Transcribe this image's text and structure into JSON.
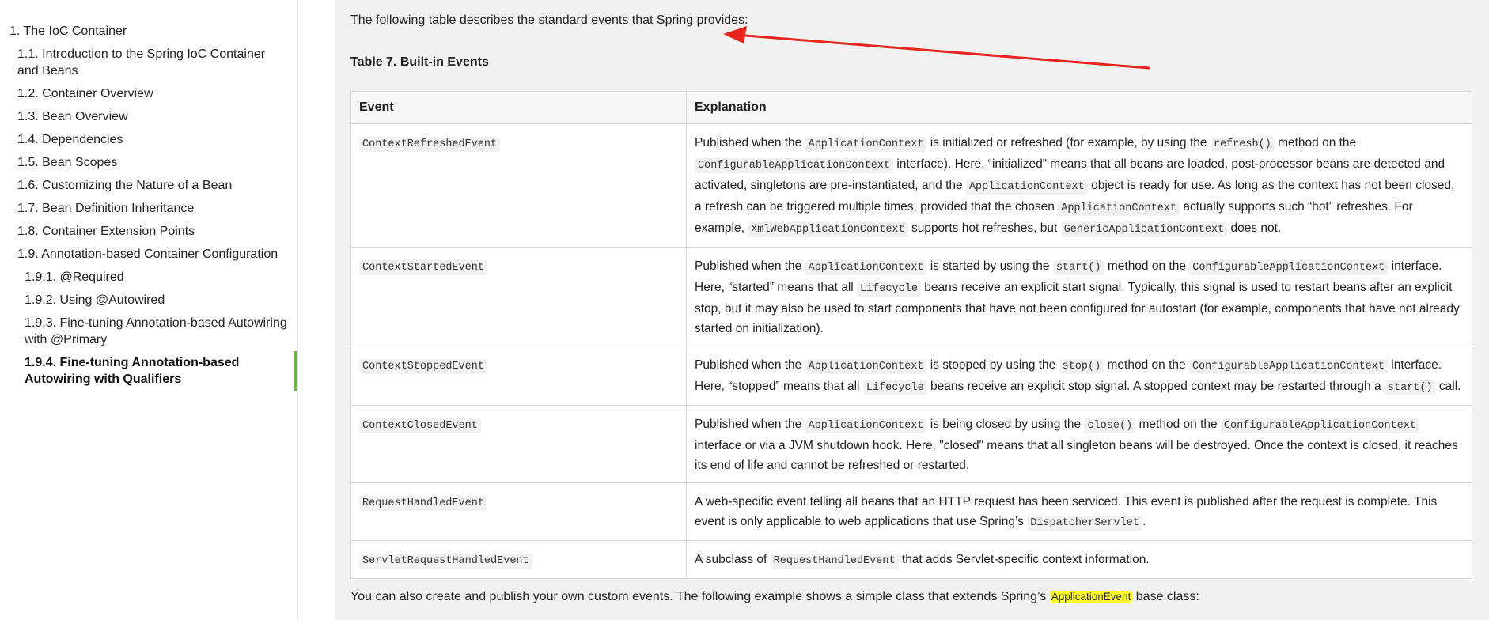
{
  "sidebar": {
    "items": [
      {
        "label": "1. The IoC Container"
      },
      {
        "label": "1.1. Introduction to the Spring IoC Container and Beans"
      },
      {
        "label": "1.2. Container Overview"
      },
      {
        "label": "1.3. Bean Overview"
      },
      {
        "label": "1.4. Dependencies"
      },
      {
        "label": "1.5. Bean Scopes"
      },
      {
        "label": "1.6. Customizing the Nature of a Bean"
      },
      {
        "label": "1.7. Bean Definition Inheritance"
      },
      {
        "label": "1.8. Container Extension Points"
      },
      {
        "label": "1.9. Annotation-based Container Configuration"
      },
      {
        "label": "1.9.1. @Required"
      },
      {
        "label": "1.9.2. Using @Autowired"
      },
      {
        "label": "1.9.3. Fine-tuning Annotation-based Autowiring with @Primary"
      },
      {
        "label": "1.9.4. Fine-tuning Annotation-based Autowiring with Qualifiers"
      }
    ]
  },
  "main": {
    "intro": "The following table describes the standard events that Spring provides:",
    "table_title": "Table 7. Built-in Events",
    "headers": {
      "event": "Event",
      "explanation": "Explanation"
    },
    "rows": [
      {
        "event": "ContextRefreshedEvent",
        "exp": {
          "t1": "Published when the ",
          "c1": "ApplicationContext",
          "t2": " is initialized or refreshed (for example, by using the ",
          "c2": "refresh()",
          "t3": " method on the ",
          "c3": "ConfigurableApplicationContext",
          "t4": " interface). Here, “initialized” means that all beans are loaded, post-processor beans are detected and activated, singletons are pre-instantiated, and the ",
          "c4": "ApplicationContext",
          "t5": " object is ready for use. As long as the context has not been closed, a refresh can be triggered multiple times, provided that the chosen ",
          "c5": "ApplicationContext",
          "t6": " actually supports such “hot” refreshes. For example, ",
          "c6": "XmlWebApplicationContext",
          "t7": " supports hot refreshes, but ",
          "c7": "GenericApplicationContext",
          "t8": " does not."
        }
      },
      {
        "event": "ContextStartedEvent",
        "exp": {
          "t1": "Published when the ",
          "c1": "ApplicationContext",
          "t2": " is started by using the ",
          "c2": "start()",
          "t3": " method on the ",
          "c3": "ConfigurableApplicationContext",
          "t4": " interface. Here, “started” means that all ",
          "c4": "Lifecycle",
          "t5": " beans receive an explicit start signal. Typically, this signal is used to restart beans after an explicit stop, but it may also be used to start components that have not been configured for autostart (for example, components that have not already started on initialization)."
        }
      },
      {
        "event": "ContextStoppedEvent",
        "exp": {
          "t1": "Published when the ",
          "c1": "ApplicationContext",
          "t2": " is stopped by using the ",
          "c2": "stop()",
          "t3": " method on the ",
          "c3": "ConfigurableApplicationContext",
          "t4": " interface. Here, “stopped” means that all ",
          "c4": "Lifecycle",
          "t5": " beans receive an explicit stop signal. A stopped context may be restarted through a ",
          "c5": "start()",
          "t6": " call."
        }
      },
      {
        "event": "ContextClosedEvent",
        "exp": {
          "t1": "Published when the ",
          "c1": "ApplicationContext",
          "t2": " is being closed by using the ",
          "c2": "close()",
          "t3": " method on the ",
          "c3": "ConfigurableApplicationContext",
          "t4": " interface or via a JVM shutdown hook. Here, \"closed\" means that all singleton beans will be destroyed. Once the context is closed, it reaches its end of life and cannot be refreshed or restarted."
        }
      },
      {
        "event": "RequestHandledEvent",
        "exp": {
          "t1": "A web-specific event telling all beans that an HTTP request has been serviced. This event is published after the request is complete. This event is only applicable to web applications that use Spring’s ",
          "c1": "DispatcherServlet",
          "t2": "."
        }
      },
      {
        "event": "ServletRequestHandledEvent",
        "exp": {
          "t1": "A subclass of ",
          "c1": "RequestHandledEvent",
          "t2": " that adds Servlet-specific context information."
        }
      }
    ],
    "outro": {
      "text": "You can also create and publish your own custom events. The following example shows a simple class that extends Spring’s ",
      "highlight": "ApplicationEvent",
      "suffix": " base class:"
    }
  },
  "colors": {
    "accent": "#6db33f",
    "annotation_arrow": "#e8251c",
    "highlight": "#ffff2a"
  }
}
